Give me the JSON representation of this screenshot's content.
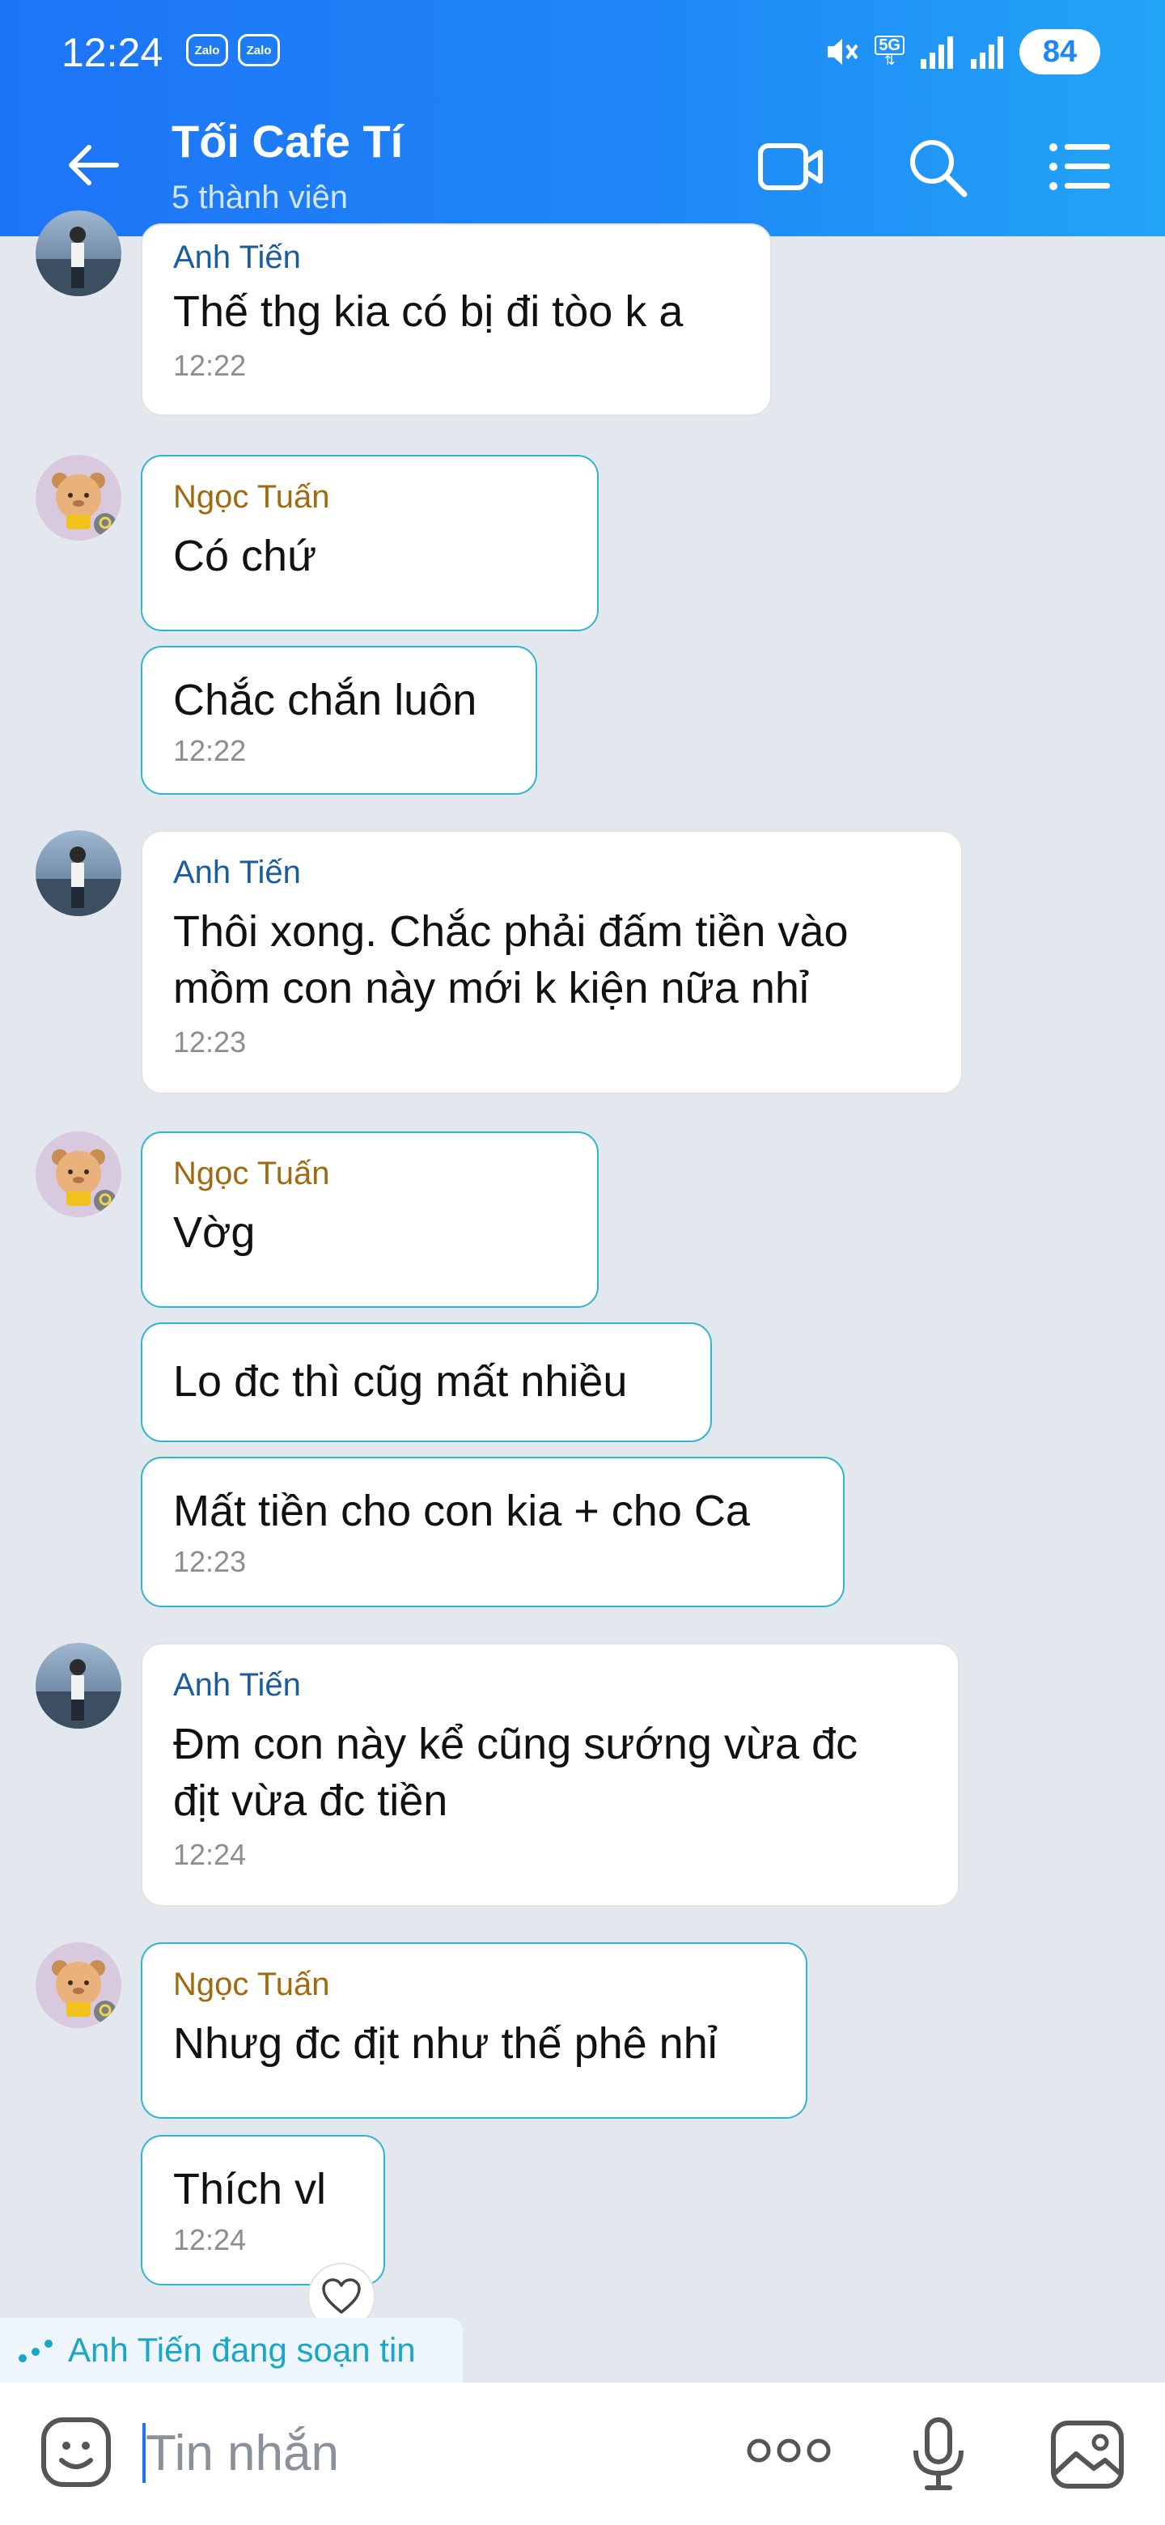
{
  "status_bar": {
    "time": "12:24",
    "app_badges": [
      "Zalo",
      "Zalo"
    ],
    "network": "5G",
    "battery": "84"
  },
  "header": {
    "title": "Tối Cafe Tí",
    "subtitle": "5 thành viên",
    "icons": [
      "back-arrow-icon",
      "video-call-icon",
      "search-icon",
      "menu-icon"
    ]
  },
  "messages": [
    {
      "sender": "Anh Tiến",
      "text": "Thế thg kia có bị đi tòo k a",
      "time": "12:22"
    },
    {
      "sender": "Ngọc Tuấn",
      "text": "Có chứ",
      "time": ""
    },
    {
      "sender": "",
      "text": "Chắc chắn luôn",
      "time": "12:22"
    },
    {
      "sender": "Anh Tiến",
      "text": "Thôi xong. Chắc phải đấm tiền vào\nmồm con này mới k kiện nữa nhỉ",
      "time": "12:23"
    },
    {
      "sender": "Ngọc Tuấn",
      "text": "Vờg",
      "time": ""
    },
    {
      "sender": "",
      "text": "Lo đc thì cũg mất nhiều",
      "time": ""
    },
    {
      "sender": "",
      "text": "Mất tiền cho con kia + cho Ca",
      "time": "12:23"
    },
    {
      "sender": "Anh Tiến",
      "text": "Đm con này kể cũng sướng vừa đc\nđịt vừa đc tiền",
      "time": "12:24"
    },
    {
      "sender": "Ngọc Tuấn",
      "text": "Nhưg đc địt như thế phê nhỉ",
      "time": ""
    },
    {
      "sender": "",
      "text": "Thích vl",
      "time": "12:24"
    }
  ],
  "typing_indicator": "Anh Tiến đang soạn tin",
  "input": {
    "placeholder": "Tin nhắn"
  },
  "colors": {
    "header_start": "#1e74f6",
    "header_end": "#22a4f7",
    "background": "#e3e7ee",
    "ngoc_border": "#2fb6cf",
    "anh_name": "#1b5c9c",
    "ngoc_name": "#a06a10"
  }
}
